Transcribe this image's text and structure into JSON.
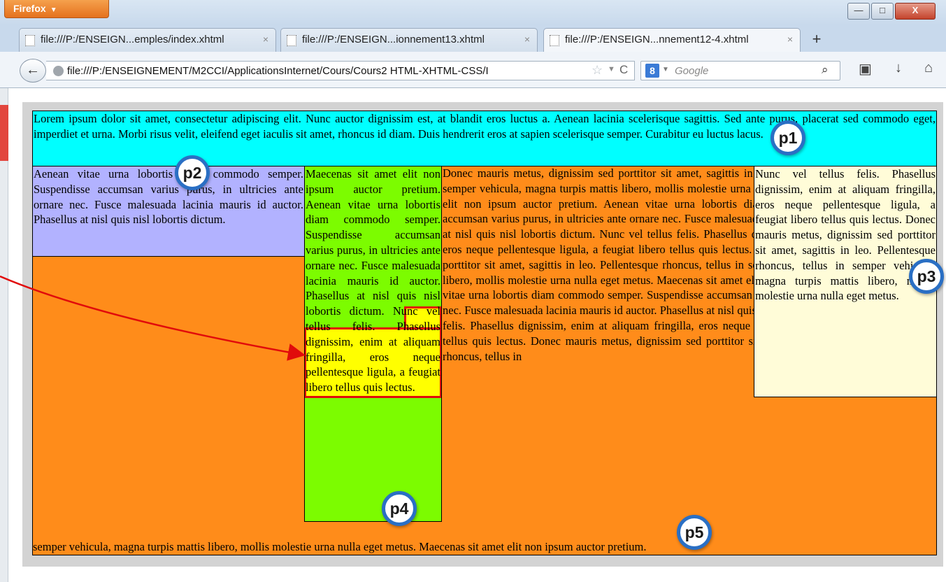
{
  "browser": {
    "menu_button": "Firefox",
    "window_controls": {
      "minimize": "—",
      "maximize": "□",
      "close": "X"
    },
    "tabs": [
      {
        "label": "file:///P:/ENSEIGN...emples/index.xhtml",
        "active": false
      },
      {
        "label": "file:///P:/ENSEIGN...ionnement13.xhtml",
        "active": false
      },
      {
        "label": "file:///P:/ENSEIGN...nnement12-4.xhtml",
        "active": true
      }
    ],
    "tab_close_glyph": "×",
    "new_tab_glyph": "+",
    "url": "file:///P:/ENSEIGNEMENT/M2CCI/ApplicationsInternet/Cours/Cours2 HTML-XHTML-CSS/I",
    "search_placeholder": "Google",
    "search_engine_label": "8",
    "icons": {
      "back": "back-arrow-icon",
      "star": "bookmark-star-icon",
      "reload": "reload-icon",
      "search": "magnifier-icon",
      "bookmarks": "bookmarks-icon",
      "downloads": "download-arrow-icon",
      "home": "home-icon"
    }
  },
  "content": {
    "p1": "Lorem ipsum dolor sit amet, consectetur adipiscing elit. Nunc auctor dignissim est, at blandit eros luctus a. Aenean lacinia scelerisque sagittis. Sed ante purus, placerat sed commodo eget, imperdiet et urna. Morbi risus velit, eleifend eget iaculis sit amet, rhoncus id diam. Duis hendrerit eros at sapien scelerisque semper. Curabitur eu luctus lacus.",
    "p2": "Aenean vitae urna lobortis diam commodo semper. Suspendisse accumsan varius purus, in ultricies ante ornare nec. Fusce malesuada lacinia mauris id auctor. Phasellus at nisl quis nisl lobortis dictum.",
    "p4": "Maecenas sit amet elit non ipsum auctor pretium. Aenean vitae urna lobortis diam commodo semper. Suspendisse accumsan varius purus, in ultricies ante ornare nec. Fusce malesuada lacinia mauris id auctor. Phasellus at nisl quis nisl lobortis dictum. Nunc vel tellus felis. Phasellus dignissim, enim at aliquam fringilla, eros neque pellentesque ligula, a feugiat libero tellus quis lectus.",
    "p3": "Nunc vel tellus felis. Phasellus dignissim, enim at aliquam fringilla, eros neque pellentesque ligula, a feugiat libero tellus quis lectus. Donec mauris metus, dignissim sed porttitor sit amet, sagittis in leo. Pellentesque rhoncus, tellus in semper vehicula, magna turpis mattis libero, mollis molestie urna nulla eget metus.",
    "p5_top": "Donec mauris metus, dignissim sed porttitor sit amet, sagittis in leo. Pellentesque rhoncus, tellus in semper vehicula, magna turpis mattis libero, mollis molestie urna nulla eget metus. Maecenas sit amet elit non ipsum auctor pretium. Aenean vitae urna lobortis diam commodo semper. Suspendisse accumsan varius purus, in ultricies ante ornare nec. Fusce malesuada lacinia mauris id auctor. Phasellus at nisl quis nisl lobortis dictum. Nunc vel tellus felis. Phasellus dignissim, enim at aliquam fringilla, eros neque pellentesque ligula, a feugiat libero tellus quis lectus. Donec mauris metus, dignissim sed porttitor sit amet, sagittis in leo. Pellentesque rhoncus, tellus in semper vehicula, magna turpis mattis libero, mollis molestie urna nulla eget metus. Maecenas sit amet elit non ipsum auctor pretium. Aenean vitae urna lobortis diam commodo semper. Suspendisse accumsan varius purus, in ultricies ante ornare nec. Fusce malesuada lacinia mauris id auctor. Phasellus at nisl quis nisl lobortis dictum. Nunc vel tellus felis. Phasellus dignissim, enim at aliquam fringilla, eros neque pellentesque ligula, a feugiat libero tellus quis lectus. Donec mauris metus, dignissim sed porttitor sit amet, sagittis in leo. Pellentesque rhoncus, tellus in",
    "p5_bottom": "semper vehicula, magna turpis mattis libero, mollis molestie urna nulla eget metus. Maecenas sit amet elit non ipsum auctor pretium.",
    "highlight_text": "Fusce malesuada lacinia mauris id auctor. Phasellus at nisl quis nisl lobortis dictum."
  },
  "annotations": {
    "badges": [
      "p1",
      "p2",
      "p3",
      "p4",
      "p5"
    ],
    "badge_color": "#2a6fc4",
    "arrow_color": "#e10b0b"
  },
  "colors": {
    "p1": "#00ffff",
    "p2": "#b2b2ff",
    "p3": "#fffcd8",
    "p4": "#7cfc00",
    "p5": "#ff8c1a",
    "highlight": "#ffff00",
    "page_bg": "#d3d3d3"
  }
}
